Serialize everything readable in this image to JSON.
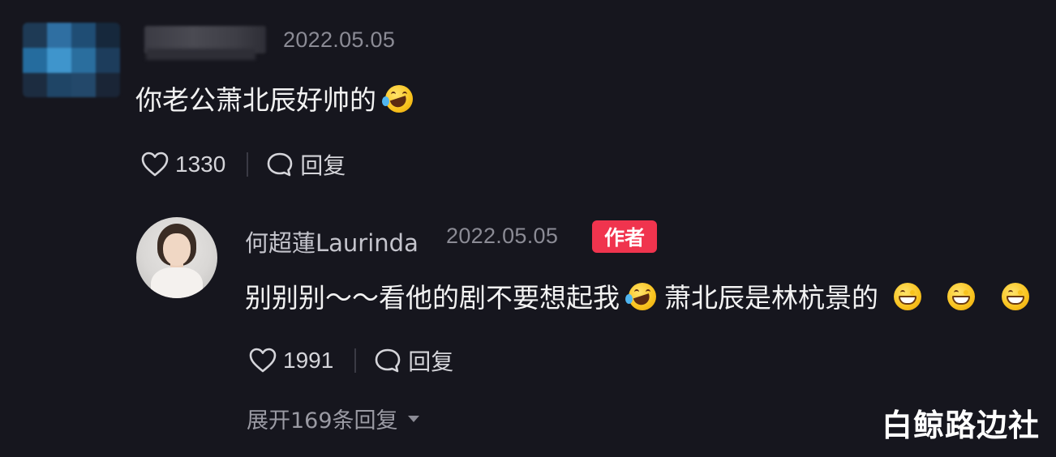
{
  "comment": {
    "date": "2022.05.05",
    "text": "你老公萧北辰好帅的",
    "text_emoji": "rolling-on-floor-laughing",
    "likes": "1330",
    "reply_label": "回复"
  },
  "reply": {
    "username": "何超蓮Laurinda",
    "date": "2022.05.05",
    "badge": "作者",
    "text_part1": "别别别～～看他的剧不要想起我",
    "text_emoji_1": "rolling-on-floor-laughing",
    "text_part2": "萧北辰是林杭景的",
    "trailing_emojis": [
      "grinning-face",
      "grinning-face",
      "grinning-face"
    ],
    "likes": "1991",
    "reply_label": "回复",
    "expand_label": "展开169条回复"
  },
  "watermark": "白鲸路边社",
  "colors": {
    "background": "#16161e",
    "badge": "#f0344e",
    "muted_text": "#8b8b95"
  }
}
